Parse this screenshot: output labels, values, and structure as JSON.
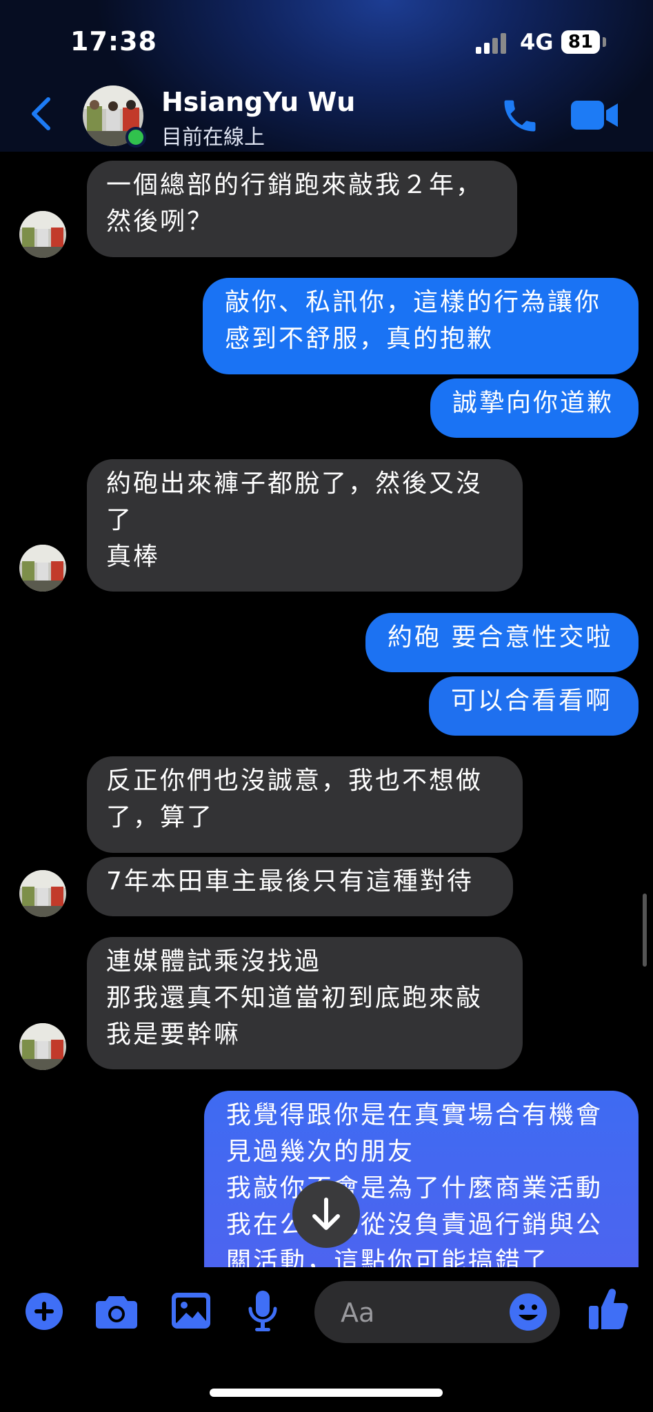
{
  "status_bar": {
    "time": "17:38",
    "network": "4G",
    "battery": "81"
  },
  "header": {
    "contact_name": "HsiangYu Wu",
    "presence": "目前在線上"
  },
  "messages": [
    {
      "side": "in",
      "text": "一個總部的行銷跑來敲我２年，\n然後咧？"
    },
    {
      "side": "out",
      "text": "敲你、私訊你，這樣的行為讓你\n感到不舒服，真的抱歉"
    },
    {
      "side": "out",
      "text": "誠摯向你道歉"
    },
    {
      "side": "in",
      "text": "約砲出來褲子都脫了，然後又沒\n了\n真棒"
    },
    {
      "side": "out",
      "text": "約砲 要合意性交啦"
    },
    {
      "side": "out",
      "text": "可以合看看啊"
    },
    {
      "side": "in",
      "text": "反正你們也沒誠意，我也不想做\n了，算了"
    },
    {
      "side": "in",
      "text": "7年本田車主最後只有這種對待"
    },
    {
      "side": "in",
      "text": "連媒體試乘沒找過\n那我還真不知道當初到底跑來敲\n我是要幹嘛"
    },
    {
      "side": "out",
      "text": "我覺得跟你是在真實場合有機會\n見過幾次的朋友\n我敲你不會是為了什麼商業活動\n我在公司也從沒負責過行銷與公\n關活動，這點你可能搞錯了"
    }
  ],
  "composer": {
    "placeholder": "Aa"
  },
  "colors": {
    "outgoing_top": "#1a73f4",
    "outgoing_bottom": "#4f63ef",
    "incoming": "#333335",
    "accent": "#1d7bf5",
    "composer_icon": "#3f6ff6"
  }
}
